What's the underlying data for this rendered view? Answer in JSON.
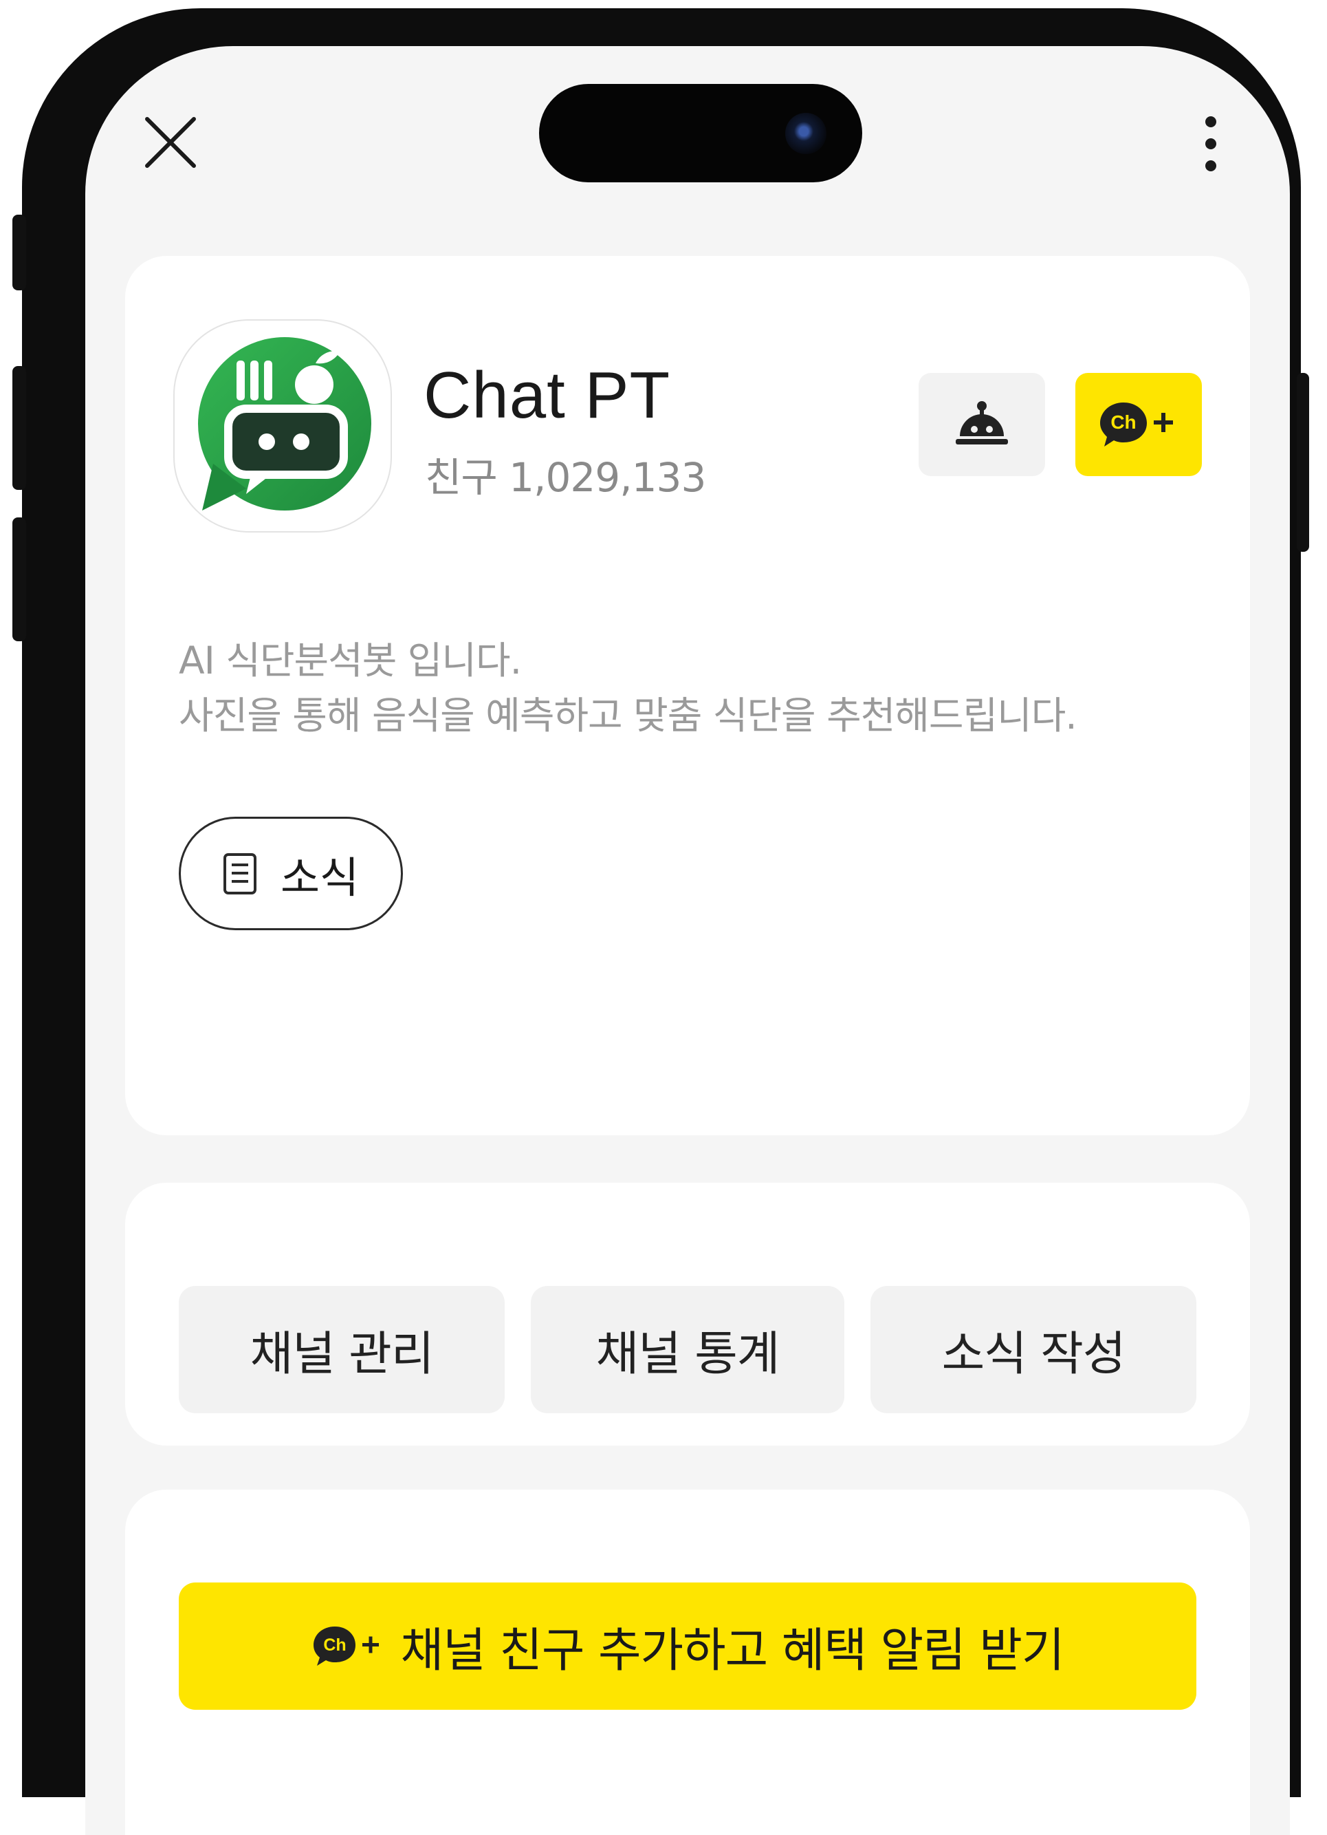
{
  "channel": {
    "name": "Chat PT",
    "friend_count": "친구 1,029,133",
    "description_line1": "AI 식단분석봇 입니다.",
    "description_line2": "사진을 통해 음식을 예측하고 맞춤 식단을 추천해드립니다."
  },
  "header_buttons": {
    "ch_badge": "Ch"
  },
  "news_button": {
    "label": "소식"
  },
  "actions": [
    {
      "label": "채널 관리"
    },
    {
      "label": "채널 통계"
    },
    {
      "label": "소식 작성"
    }
  ],
  "promo": {
    "badge": "Ch",
    "label": "채널 친구 추가하고 혜택 알림 받기"
  },
  "icons": {
    "close": "close-icon",
    "more": "more-vertical-icon",
    "bot": "chatbot-icon",
    "channel_add": "channel-add-icon",
    "news": "document-icon",
    "logo": "chatpt-logo"
  },
  "colors": {
    "kakao_yellow": "#fee500",
    "logo_green": "#2ea84e",
    "screen_bg": "#f5f5f5"
  }
}
